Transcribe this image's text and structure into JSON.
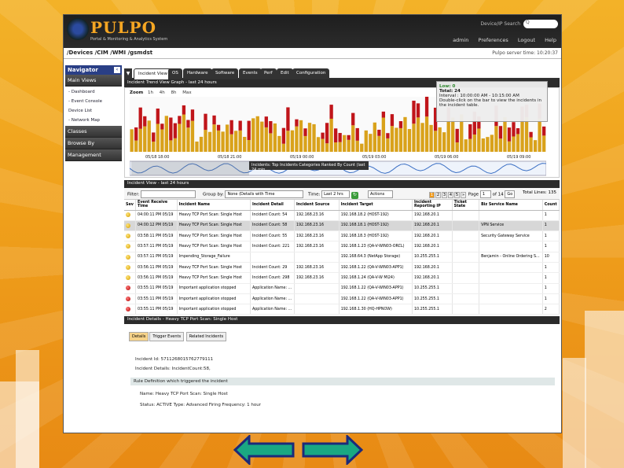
{
  "app": {
    "logo": "PULPO",
    "logo_sub": "Portal & Monitoring & Analytics System",
    "device_search_label": "Device/IP Search",
    "search_placeholder": "Q"
  },
  "top_links": [
    "admin",
    "Preferences",
    "Logout",
    "Help"
  ],
  "breadcrumb": "/Devices /CIM /WMI /gsmdst",
  "server_time": "Pulpo server time: 10:20:37",
  "navigator": {
    "title": "Navigator",
    "sections": [
      "Main Views",
      "Classes",
      "Browse By",
      "Management"
    ],
    "main_items": [
      "- Dashboard",
      "- Event Console",
      "Device List",
      "- Network Map"
    ]
  },
  "tabs": [
    "Incident View",
    "OS",
    "Hardware",
    "Software",
    "Events",
    "Perf",
    "Edit",
    "Configuration"
  ],
  "trend": {
    "title": "Incident Trend View Graph - last 24 hours",
    "zoom_label": "Zoom",
    "zoom_options": [
      "1h",
      "4h",
      "8h",
      "Max"
    ],
    "time_labels": [
      "05/18 18:00",
      "05/18 21:00",
      "05/19 00:00",
      "05/19 03:00",
      "05/19 06:00",
      "05/19 09:00"
    ],
    "range_bar": "Incidents: Top Incidents Categories Ranked By Count (last 24 min...",
    "tooltip": {
      "line1": "Low: 0",
      "line2": "Total: 24",
      "line3": "Interval : 10:00:00 AM - 10:15:00 AM",
      "line4": "Double-click on the bar to view the incidents in the incident table."
    },
    "colors": {
      "bar_low": "#d9a21b",
      "bar_high": "#c0151a",
      "navigator_line": "#3b6fc4"
    }
  },
  "incident_view": {
    "title": "Incident View - last 24 hours",
    "filter_label": "Filter:",
    "group_label": "Group by:",
    "group_value": "None (Details with Time",
    "time_label": "Time:",
    "time_value": "Last 2 hrs",
    "actions_label": "Actions",
    "pages": [
      "1",
      "2",
      "3",
      "4",
      "5"
    ],
    "page_label": "Page",
    "page_value": "1",
    "page_of": "of 14",
    "go_label": "Go",
    "total_lines": "Total Lines: 135",
    "columns": [
      "Sev",
      "Event Receive Time",
      "Incident Name",
      "Incident Detail",
      "Incident Source",
      "Incident Target",
      "Incident Reporting IP",
      "Ticket State",
      "Biz Service Name",
      "Count"
    ],
    "rows": [
      {
        "sev": "y",
        "time": "04:00:11 PM 05/19",
        "name": "Heavy TCP Port Scan: Single Host",
        "detail": "Incident Count: 54",
        "source": "192.168.23.16",
        "target": "192.168.18.2 (HOST-192)",
        "ip": "192.168.20.1",
        "ticket": "",
        "biz": "",
        "count": "1"
      },
      {
        "sev": "y",
        "time": "04:00:12 PM 05/19",
        "name": "Heavy TCP Port Scan: Single Host",
        "detail": "Incident Count: 58",
        "source": "192.168.23.16",
        "target": "192.168.18.1 (HOST-192)",
        "ip": "192.168.20.1",
        "ticket": "",
        "biz": "VPN Service",
        "count": "1"
      },
      {
        "sev": "y",
        "time": "03:58:11 PM 05/19",
        "name": "Heavy TCP Port Scan: Single Host",
        "detail": "Incident Count: 55",
        "source": "192.168.23.16",
        "target": "192.168.18.3 (HOST-192)",
        "ip": "192.168.20.1",
        "ticket": "",
        "biz": "Security Gateway Service",
        "count": "1"
      },
      {
        "sev": "y",
        "time": "03:57:11 PM 05/19",
        "name": "Heavy TCP Port Scan: Single Host",
        "detail": "Incident Count: 221",
        "source": "192.168.23.16",
        "target": "192.168.1.23 (QA-V-WIN03-ORCL)",
        "ip": "192.168.20.1",
        "ticket": "",
        "biz": "",
        "count": "1"
      },
      {
        "sev": "y",
        "time": "03:57:11 PM 05/19",
        "name": "Impending_Storage_Failure",
        "detail": "",
        "source": "",
        "target": "192.168.64.3 (NetApp Storage)",
        "ip": "10.255.255.1",
        "ticket": "",
        "biz": "Benjamin - Online Ordering S...",
        "count": "10"
      },
      {
        "sev": "y",
        "time": "03:56:11 PM 05/19",
        "name": "Heavy TCP Port Scan: Single Host",
        "detail": "Incident Count: 29",
        "source": "192.168.23.16",
        "target": "192.168.1.22 (QA-V-WIN03-APP1)",
        "ip": "192.168.20.1",
        "ticket": "",
        "biz": "",
        "count": "1"
      },
      {
        "sev": "y",
        "time": "03:56:11 PM 05/19",
        "name": "Heavy TCP Port Scan: Single Host",
        "detail": "Incident Count: 298",
        "source": "192.168.23.16",
        "target": "192.168.1.24 (QA-V-W MI24)",
        "ip": "192.168.20.1",
        "ticket": "",
        "biz": "",
        "count": "1"
      },
      {
        "sev": "r",
        "time": "03:55:11 PM 05/19",
        "name": "Important application stopped",
        "detail": "Application Name: ...",
        "source": "",
        "target": "192.168.1.22 (QA-V-WIN03-APP1)",
        "ip": "10.255.255.1",
        "ticket": "",
        "biz": "",
        "count": "1"
      },
      {
        "sev": "r",
        "time": "03:55:11 PM 05/19",
        "name": "Important application stopped",
        "detail": "Application Name: ...",
        "source": "",
        "target": "192.168.1.22 (QA-V-WIN03-APP1)",
        "ip": "10.255.255.1",
        "ticket": "",
        "biz": "",
        "count": "1"
      },
      {
        "sev": "r",
        "time": "03:55:11 PM 05/19",
        "name": "Important application stopped",
        "detail": "Application Name: ...",
        "source": "",
        "target": "192.168.1.30 (HQ-HPNOW)",
        "ip": "10.255.255.1",
        "ticket": "",
        "biz": "",
        "count": "2"
      }
    ]
  },
  "incident_details": {
    "title": "Incident Details - Heavy TCP Port Scan: Single Host",
    "tabs": [
      "Details",
      "Trigger Events",
      "Related Incidents"
    ],
    "incident_id": "Incident Id:  5711268015762779111",
    "incident_details": "Incident Details:  IncidentCount:58,",
    "rule_bar": "Rule Definition which triggered the incident",
    "name_line": "Name:   Heavy TCP Port Scan: Single Host",
    "status_line": "Status:  ACTIVE    Type:  Advanced    Firing Frequency:  1 hour"
  }
}
